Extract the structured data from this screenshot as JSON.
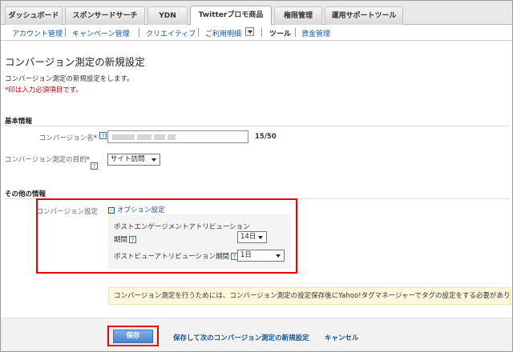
{
  "tabs": [
    {
      "label": "ダッシュボード"
    },
    {
      "label": "スポンサードサーチ"
    },
    {
      "label": "YDN"
    },
    {
      "label": "Twitterプロモ商品"
    },
    {
      "label": "権限管理"
    },
    {
      "label": "運用サポートツール"
    }
  ],
  "subnav": [
    {
      "label": "アカウント管理"
    },
    {
      "label": "キャンペーン管理"
    },
    {
      "label": "クリエイティブ"
    },
    {
      "label": "ご利用明細"
    },
    {
      "label": "ツール"
    },
    {
      "label": "資金管理"
    }
  ],
  "page": {
    "title": "コンバージョン測定の新規設定",
    "description": "コンバージョン測定の新規設定をします。",
    "required_note": "*印は入力必須項目です。"
  },
  "basic": {
    "heading": "基本情報",
    "name_label": "コンバージョン名",
    "name_count": "15/50",
    "purpose_label": "コンバージョン測定の目的",
    "purpose_value": "サイト訪問"
  },
  "other": {
    "heading": "その他の情報",
    "cv_setting_label": "コンバージョン設定",
    "option_link": "オプション設定",
    "engagement_label_line1": "ポストエンゲージメントアトリビューション",
    "engagement_label_line2": "期間",
    "engagement_value": "14日",
    "view_label": "ポストビューアトリビューション期間",
    "view_value": "1日"
  },
  "info_message": "コンバージョン測定を行うためには、コンバージョン測定の設定保存後にYahoo!タグマネージャーでタグの設定をする必要があります。",
  "footer": {
    "save": "保存",
    "save_and_new": "保存して次のコンバージョン測定の新規設定",
    "cancel": "キャンセル"
  },
  "colors": {
    "link": "#15559a",
    "highlight_border": "#ee0000",
    "save_button": "#4c84cc"
  }
}
